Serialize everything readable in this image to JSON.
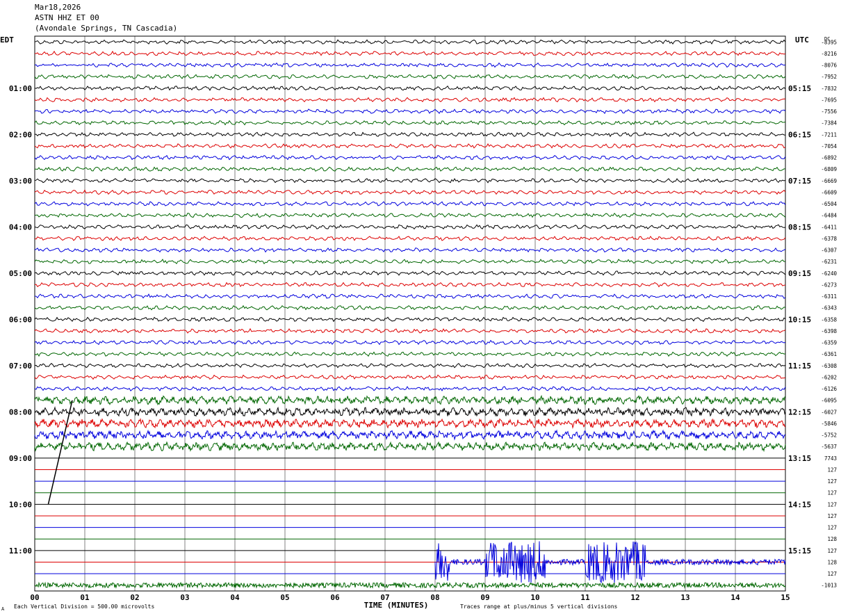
{
  "header": {
    "date": "Mar18,2026",
    "station": "ASTN HHZ ET 00",
    "location": "(Avondale Springs, TN Cascadia)"
  },
  "chart_data": {
    "type": "line",
    "title": "ASTN HHZ ET 00",
    "left_axis_title": "EDT",
    "right_axis_title": "UTC",
    "dc_title": "DC",
    "xlabel": "TIME (MINUTES)",
    "xlim": [
      0,
      15
    ],
    "x_ticks": [
      "00",
      "01",
      "02",
      "03",
      "04",
      "05",
      "06",
      "07",
      "08",
      "09",
      "10",
      "11",
      "12",
      "13",
      "14",
      "15"
    ],
    "left_hour_labels": [
      "01:00",
      "02:00",
      "03:00",
      "04:00",
      "05:00",
      "06:00",
      "07:00",
      "08:00",
      "09:00",
      "10:00",
      "11:00"
    ],
    "right_hour_labels": [
      "05:15",
      "06:15",
      "07:15",
      "08:15",
      "09:15",
      "10:15",
      "11:15",
      "12:15",
      "13:15",
      "14:15",
      "15:15"
    ],
    "trace_colors": [
      "#000000",
      "#dd0000",
      "#0000dd",
      "#006600"
    ],
    "rows_per_hour": 4,
    "minutes_per_row": 15,
    "dc_offsets": [
      "-8395",
      "-8216",
      "-8076",
      "-7952",
      "-7832",
      "-7695",
      "-7556",
      "-7384",
      "-7211",
      "-7054",
      "-6892",
      "-6809",
      "-6669",
      "-6609",
      "-6504",
      "-6484",
      "-6411",
      "-6378",
      "-6307",
      "-6231",
      "-6240",
      "-6273",
      "-6311",
      "-6343",
      "-6358",
      "-6398",
      "-6359",
      "-6361",
      "-6308",
      "-6202",
      "-6126",
      "-6095",
      "-6027",
      "-5846",
      "-5752",
      "-5637",
      "7743",
      "127",
      "127",
      "127",
      "127",
      "127",
      "127",
      "128",
      "127",
      "128",
      "127",
      "-1013"
    ],
    "footer_left": "Each Vertical Division =  500.00 microvolts",
    "footer_right": "Traces range at plus/minus 5 vertical divisions",
    "corner_mark": "A"
  }
}
